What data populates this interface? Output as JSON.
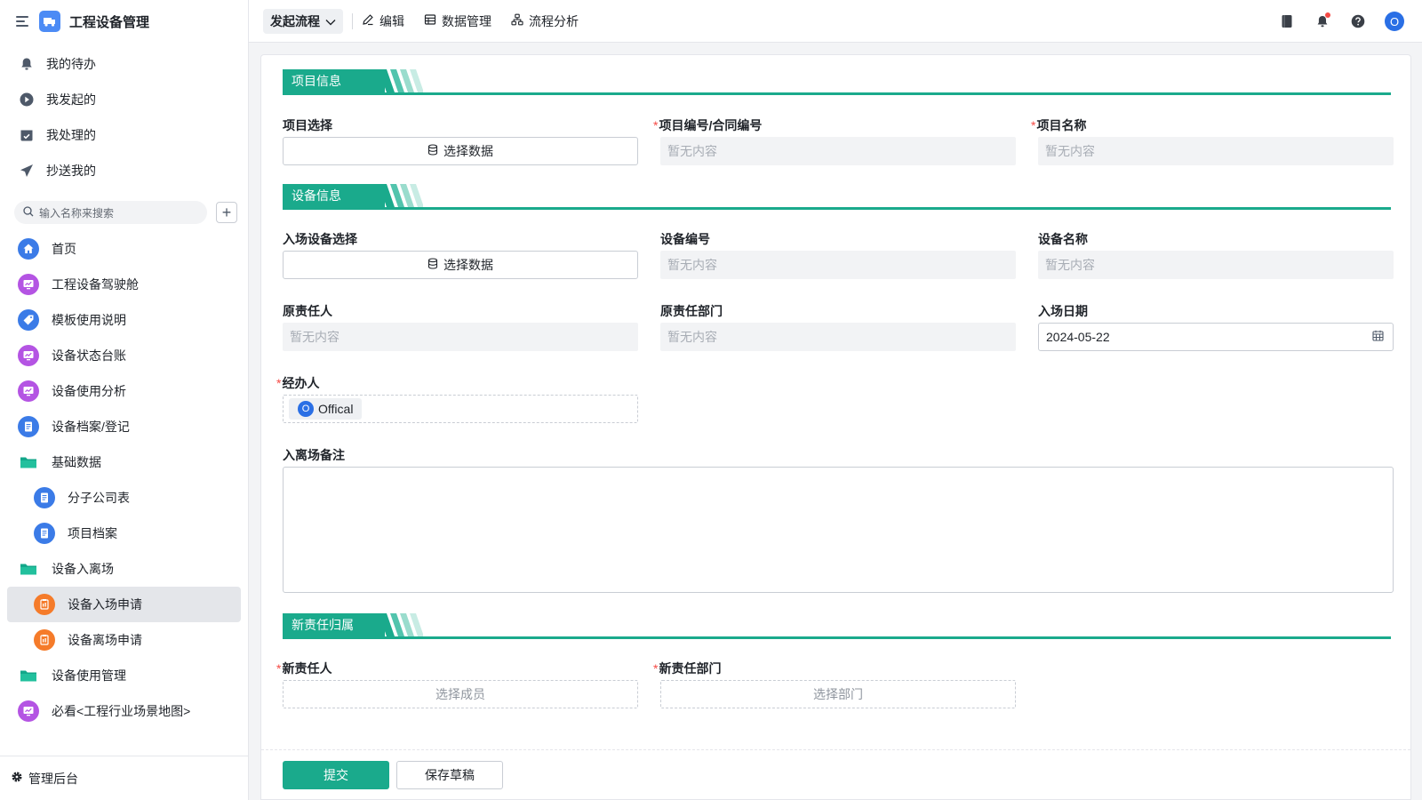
{
  "app": {
    "title": "工程设备管理"
  },
  "quick": [
    {
      "label": "我的待办",
      "icon": "bell-icon"
    },
    {
      "label": "我发起的",
      "icon": "play-circle-icon"
    },
    {
      "label": "我处理的",
      "icon": "calendar-check-icon"
    },
    {
      "label": "抄送我的",
      "icon": "send-icon"
    }
  ],
  "search": {
    "placeholder": "输入名称来搜索"
  },
  "nav": [
    {
      "label": "首页",
      "icon": "home-icon",
      "color": "#3b7be7"
    },
    {
      "label": "工程设备驾驶舱",
      "icon": "dashboard-icon",
      "color": "#b454e3"
    },
    {
      "label": "模板使用说明",
      "icon": "tag-icon",
      "color": "#3b7be7"
    },
    {
      "label": "设备状态台账",
      "icon": "dashboard-icon",
      "color": "#b454e3"
    },
    {
      "label": "设备使用分析",
      "icon": "dashboard-icon",
      "color": "#b454e3"
    },
    {
      "label": "设备档案/登记",
      "icon": "document-icon",
      "color": "#3b7be7"
    },
    {
      "label": "基础数据",
      "icon": "folder-icon",
      "color": "#13a78a"
    },
    {
      "label": "分子公司表",
      "icon": "document-icon",
      "color": "#3b7be7"
    },
    {
      "label": "项目档案",
      "icon": "document-icon",
      "color": "#3b7be7"
    },
    {
      "label": "设备入离场",
      "icon": "folder-icon",
      "color": "#13a78a"
    },
    {
      "label": "设备入场申请",
      "icon": "form-icon",
      "color": "#f57b2a"
    },
    {
      "label": "设备离场申请",
      "icon": "form-icon",
      "color": "#f57b2a"
    },
    {
      "label": "设备使用管理",
      "icon": "folder-icon",
      "color": "#13a78a"
    },
    {
      "label": "必看<工程行业场景地图>",
      "icon": "dashboard-icon",
      "color": "#b454e3"
    }
  ],
  "footer": {
    "admin": "管理后台"
  },
  "toolbar": {
    "primary": "发起流程",
    "edit": "编辑",
    "data_manage": "数据管理",
    "flow_analysis": "流程分析",
    "avatar": "O"
  },
  "form": {
    "section1": "项目信息",
    "section2": "设备信息",
    "section3": "新责任归属",
    "project_select_label": "项目选择",
    "project_no_label": "项目编号/合同编号",
    "project_name_label": "项目名称",
    "device_select_label": "入场设备选择",
    "device_no_label": "设备编号",
    "device_name_label": "设备名称",
    "orig_owner_label": "原责任人",
    "orig_dept_label": "原责任部门",
    "entry_date_label": "入场日期",
    "handler_label": "经办人",
    "remark_label": "入离场备注",
    "new_owner_label": "新责任人",
    "new_dept_label": "新责任部门",
    "select_data": "选择数据",
    "empty": "暂无内容",
    "entry_date": "2024-05-22",
    "handler_initial": "O",
    "handler_name": "Offical",
    "select_member": "选择成员",
    "select_dept": "选择部门",
    "required_mark": "*"
  },
  "actions": {
    "submit": "提交",
    "save_draft": "保存草稿"
  },
  "colors": {
    "accent": "#1aaa8c",
    "primary_blue": "#2a6fe5",
    "required": "#f54a45"
  }
}
